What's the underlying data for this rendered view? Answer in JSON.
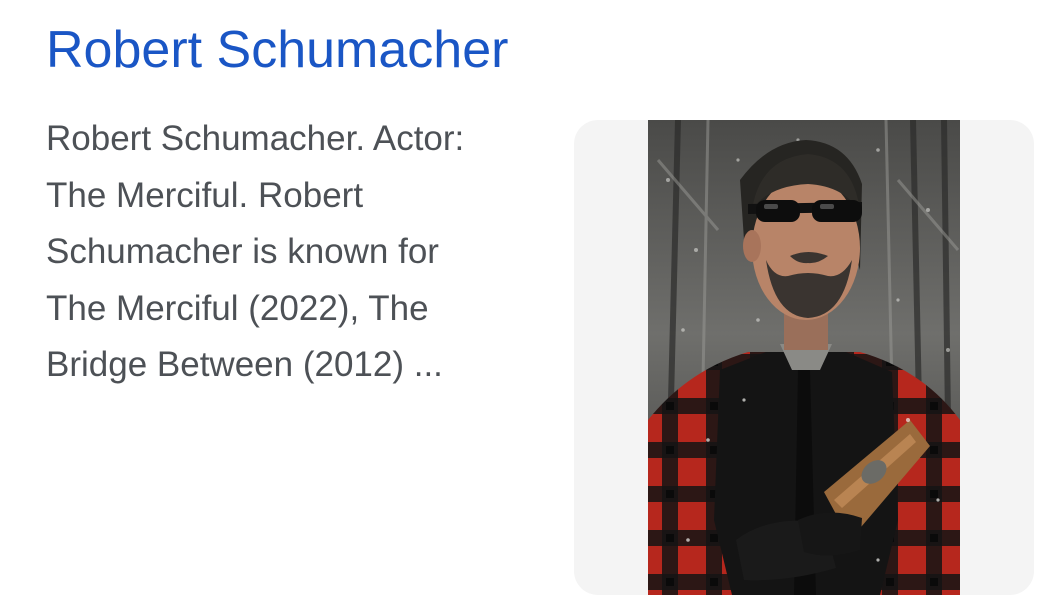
{
  "result": {
    "title": "Robert Schumacher",
    "snippet_lines": [
      "Robert Schumacher. Actor:",
      "The Merciful. Robert",
      "Schumacher is known for",
      "The Merciful (2022), The",
      "Bridge Between (2012) ..."
    ]
  },
  "colors": {
    "title_link": "#1a56c5",
    "snippet_text": "#4d5156",
    "thumbnail_background": "#f4f4f4"
  }
}
